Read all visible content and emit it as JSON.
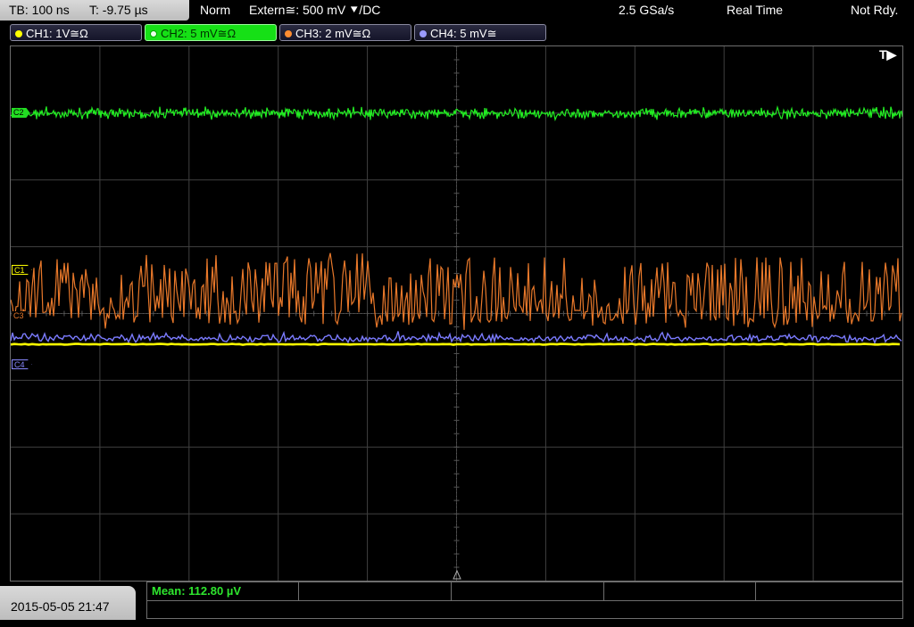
{
  "status_bar": {
    "timebase": "TB: 100 ns",
    "trigger_time": "T: -9.75 µs",
    "mode": "Norm",
    "trigger_source": "Extern≅: 500 mV ⯆/DC",
    "sample_rate": "2.5 GSa/s",
    "acq_mode": "Real Time",
    "ready_state": "Not Rdy."
  },
  "channels": [
    {
      "label": "CH1: 1V≅Ω",
      "color": "#ffff00",
      "active": false
    },
    {
      "label": "CH2: 5 mV≅Ω",
      "color": "#22dd22",
      "active": true
    },
    {
      "label": "CH3: 2 mV≅Ω",
      "color": "#ff8c30",
      "active": false
    },
    {
      "label": "CH4: 5 mV≅",
      "color": "#8888ff",
      "active": false
    }
  ],
  "markers": {
    "trigger": "T▶",
    "c1": "C1",
    "c2": "C2",
    "c3": "C3",
    "c4": "C4"
  },
  "footer": {
    "datetime": "2015-05-05 21:47",
    "measurement": "Mean: 112.80 µV"
  },
  "colors": {
    "ch1": "#ffff00",
    "ch2": "#22dd22",
    "ch3": "#e8782a",
    "ch4": "#7b7bff",
    "grid": "#404040"
  }
}
